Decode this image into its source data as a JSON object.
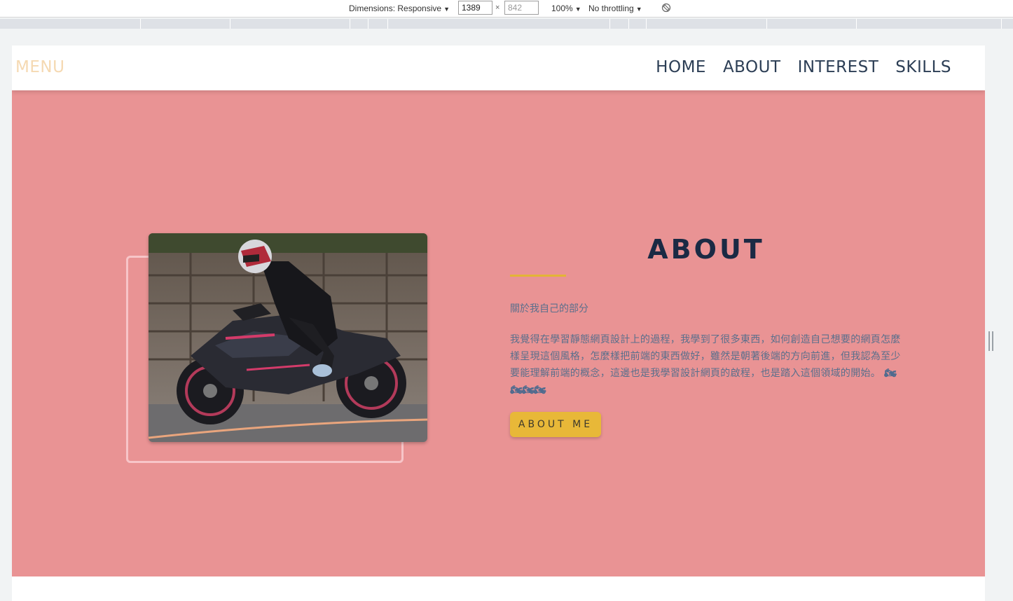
{
  "devtools": {
    "dimensions_label": "Dimensions: Responsive",
    "width_value": "1389",
    "height_placeholder": "842",
    "times": "×",
    "zoom": "100%",
    "throttling": "No throttling",
    "caret": "▼"
  },
  "site": {
    "menu_logo": "MENU",
    "nav": [
      "HOME",
      "ABOUT",
      "INTEREST",
      "SKILLS"
    ]
  },
  "about": {
    "title": "ABOUT",
    "subtitle": "關於我自己的部分",
    "body": "我覺得在學習靜態網頁設計上的過程，我學到了很多東西，如何創造自己想要的網頁怎麼樣呈現這個風格，怎麼樣把前端的東西做好，雖然是朝著後端的方向前進，但我認為至少要能理解前端的概念，這邊也是我學習設計網頁的啟程，也是踏入這個領域的開始。",
    "emoji": "🏍🏍🏍🏍",
    "button": "ABOUT ME",
    "accent_color": "#e8b838",
    "background_color": "#e99394"
  }
}
